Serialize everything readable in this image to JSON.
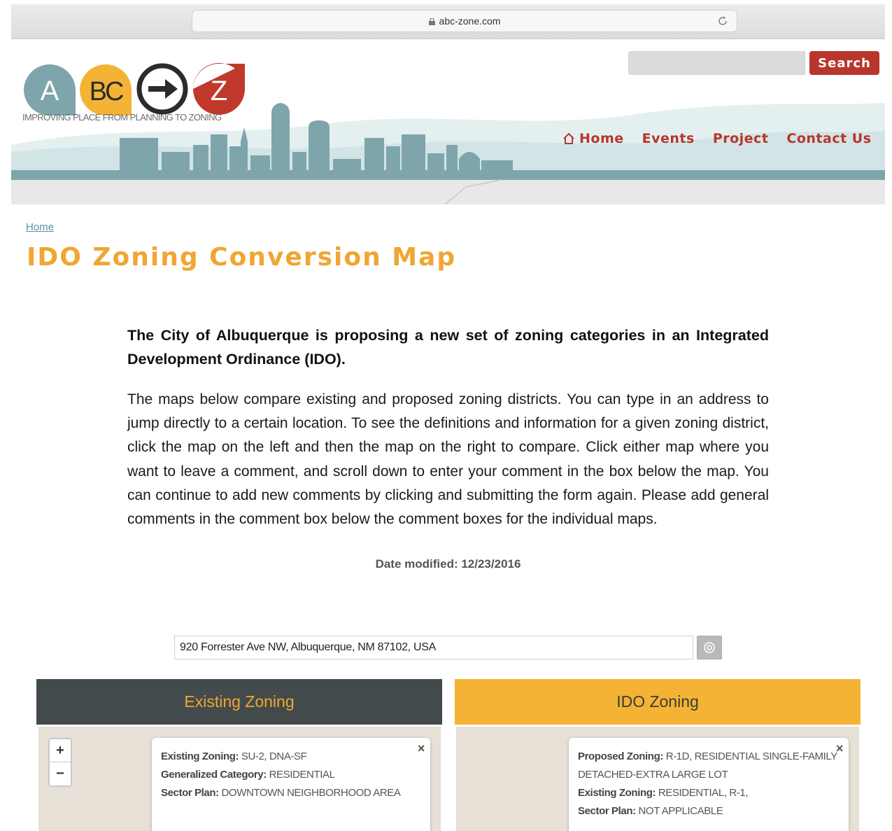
{
  "browser": {
    "url": "abc-zone.com"
  },
  "header": {
    "logo": {
      "letter_a": "A",
      "letters_bc": "BC",
      "letter_z": "Z",
      "tagline": "IMPROVING PLACE FROM PLANNING TO ZONING"
    },
    "search_label": "Search",
    "nav": [
      {
        "label": "Home",
        "icon": "home-icon"
      },
      {
        "label": "Events"
      },
      {
        "label": "Project"
      },
      {
        "label": "Contact Us"
      }
    ],
    "colors": {
      "brand_red": "#b8362b",
      "brand_orange": "#f0a632",
      "skyline_teal": "#7ea5ab"
    }
  },
  "breadcrumb": "Home",
  "page_title": "IDO Zoning Conversion Map",
  "intro": "The City of Albuquerque is proposing a new set of zoning categories in an Integrated Development Ordinance (IDO).",
  "body": "The maps below compare existing and proposed zoning districts. You can type in an address to jump directly to a certain location. To see the definitions and information for a given zoning district, click the map on the left and then the map on the right to compare. Click either map where you want to leave a comment, and scroll down to enter your comment in the box below the map. You can continue to add new comments by clicking and submitting the form again.  Please add general comments in the comment box below the comment boxes for the individual maps.",
  "date_modified": "Date modified: 12/23/2016",
  "address": {
    "value": "920 Forrester Ave NW, Albuquerque, NM 87102, USA"
  },
  "panels": {
    "left": {
      "title": "Existing Zoning",
      "zoom_in": "+",
      "zoom_out": "−",
      "close": "×",
      "popup": [
        {
          "label": "Existing Zoning:",
          "value": " SU-2, DNA-SF"
        },
        {
          "label": "Generalized Category:",
          "value": " RESIDENTIAL"
        },
        {
          "label": "Sector Plan:",
          "value": " DOWNTOWN NEIGHBORHOOD AREA"
        }
      ]
    },
    "right": {
      "title": "IDO Zoning",
      "close": "×",
      "popup": [
        {
          "label": "Proposed Zoning:",
          "value": " R-1D, RESIDENTIAL SINGLE-FAMILY DETACHED-EXTRA LARGE LOT"
        },
        {
          "label": "Existing Zoning:",
          "value": " RESIDENTIAL, R-1,"
        },
        {
          "label": "Sector Plan:",
          "value": " NOT APPLICABLE"
        }
      ]
    }
  }
}
